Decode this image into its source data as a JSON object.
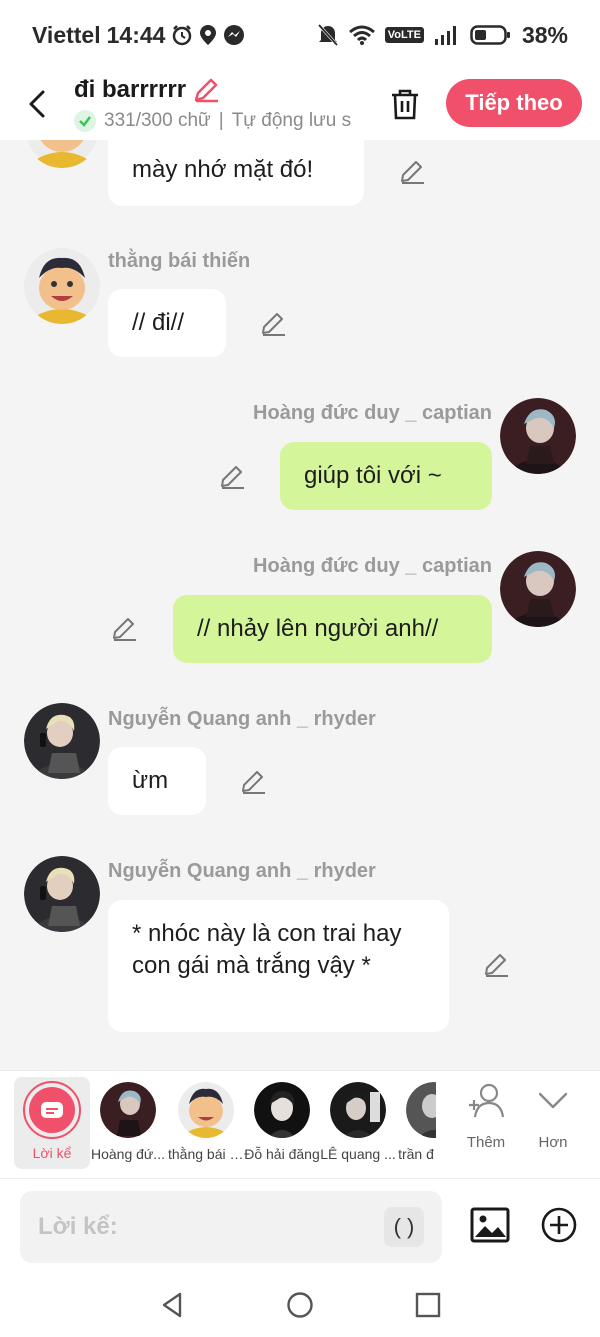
{
  "status_bar": {
    "carrier": "Viettel",
    "time": "14:44",
    "network_badge": "VoLTE",
    "battery": "38%"
  },
  "header": {
    "title": "đi barrrrrr",
    "word_count": "331/300 chữ",
    "separator": "|",
    "autosave": "Tự động lưu s",
    "next_button": "Tiếp theo"
  },
  "messages": [
    {
      "speaker": "",
      "text": "mày nhớ mặt đó!",
      "side": "left"
    },
    {
      "speaker": "thằng bái thiến",
      "text": "// đi//",
      "side": "left"
    },
    {
      "speaker": "Hoàng đức duy _ captian",
      "text": "giúp tôi  với ~",
      "side": "right"
    },
    {
      "speaker": "Hoàng đức duy _ captian",
      "text": "// nhảy lên người anh//",
      "side": "right"
    },
    {
      "speaker": "Nguyễn Quang anh _ rhyder",
      "text": "ừm",
      "side": "left"
    },
    {
      "speaker": "Nguyễn Quang anh _ rhyder",
      "text": "* nhóc này là con trai hay con gái mà trắng vậy *",
      "side": "left"
    }
  ],
  "speakers": {
    "narrator": "Lời kể",
    "items": [
      "Hoàng đứ...",
      "thằng bái t...",
      "Đỗ hải đăng",
      "LÊ quang ...",
      "trần đ"
    ],
    "add_label": "Thêm",
    "more_label": "Hơn"
  },
  "input": {
    "placeholder": "Lời kể:",
    "paren_button": "( )"
  },
  "colors": {
    "accent": "#f0506a",
    "right_bubble": "#d5f59a",
    "background": "#f4f4f4"
  }
}
